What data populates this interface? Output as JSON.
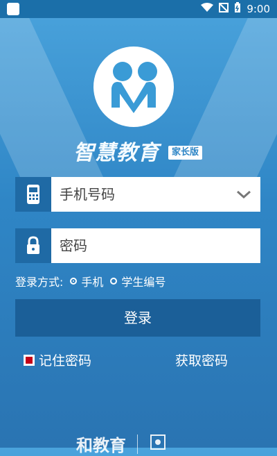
{
  "status_bar": {
    "time": "9:00"
  },
  "brand": {
    "title": "智慧教育",
    "badge": "家长版"
  },
  "form": {
    "phone_field_text": "手机号码",
    "password_field_text": "密码",
    "login_mode_label": "登录方式:",
    "mode_options": [
      {
        "label": "手机",
        "selected": true
      },
      {
        "label": "学生编号",
        "selected": false
      }
    ],
    "login_button": "登录",
    "remember_label": "记住密码",
    "get_password_link": "获取密码"
  },
  "footer": {
    "text": "和教育"
  },
  "colors": {
    "primary_dark": "#1b5f98",
    "accent_blue": "#2f86c6",
    "checkbox_red": "#c40018"
  },
  "icons": {
    "phone": "phone-icon",
    "lock": "lock-icon",
    "dropdown": "chevron-down-icon"
  }
}
